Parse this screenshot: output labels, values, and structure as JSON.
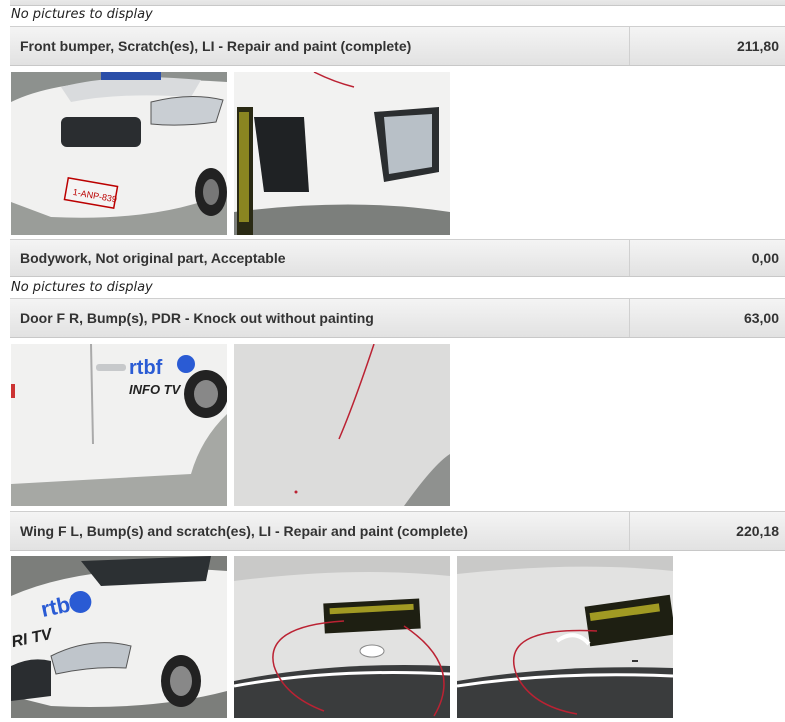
{
  "messages": {
    "no_pictures": "No pictures to display"
  },
  "rows": [
    {
      "description": "Front bumper, Scratch(es), LI - Repair and paint (complete)",
      "amount": "211,80"
    },
    {
      "description": "Bodywork, Not original part, Acceptable",
      "amount": "0,00"
    },
    {
      "description": "Door F R, Bump(s), PDR - Knock out without painting",
      "amount": "63,00"
    },
    {
      "description": "Wing F L, Bump(s) and scratch(es), LI - Repair and paint (complete)",
      "amount": "220,18"
    }
  ],
  "photo_text": {
    "plate": "1-ANP-839",
    "logo_a": "rtbf",
    "logo_b": "INFO TV",
    "logo_c": "RI TV"
  }
}
